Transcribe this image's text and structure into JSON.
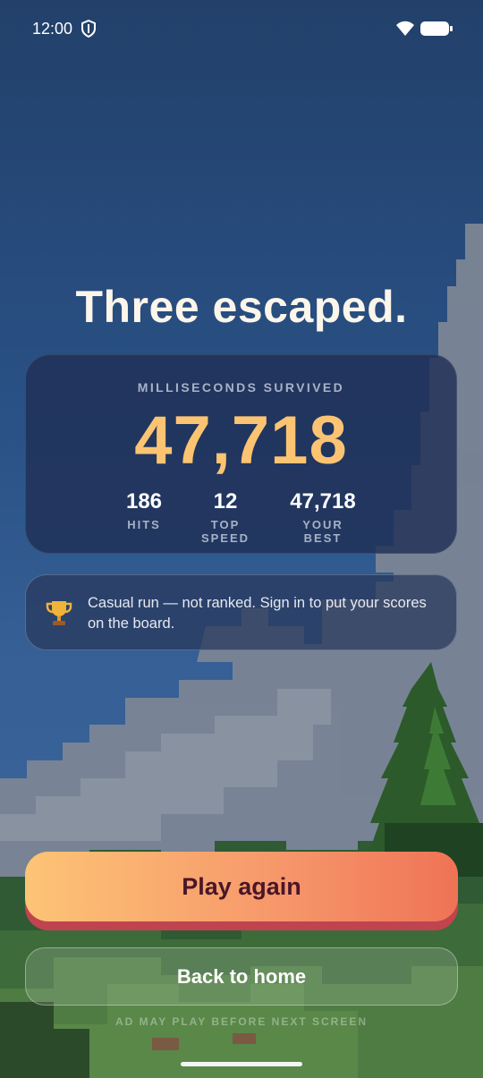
{
  "status_bar": {
    "time": "12:00"
  },
  "title": "Three escaped.",
  "score_card": {
    "label": "MILLISECONDS SURVIVED",
    "value": "47,718",
    "stats": [
      {
        "value": "186",
        "label": "HITS"
      },
      {
        "value": "12",
        "label": "TOP SPEED"
      },
      {
        "value": "47,718",
        "label": "YOUR BEST"
      }
    ]
  },
  "notice": {
    "icon": "trophy-icon",
    "text": "Casual run — not ranked. Sign in to put your scores on the board."
  },
  "buttons": {
    "play_again": "Play again",
    "back_home": "Back to home"
  },
  "ad_note": "AD MAY PLAY BEFORE NEXT SCREEN",
  "colors": {
    "score": "#fcc472",
    "play_gradient_start": "#fdc476",
    "play_gradient_end": "#ef7356",
    "play_text": "#4a1628"
  }
}
